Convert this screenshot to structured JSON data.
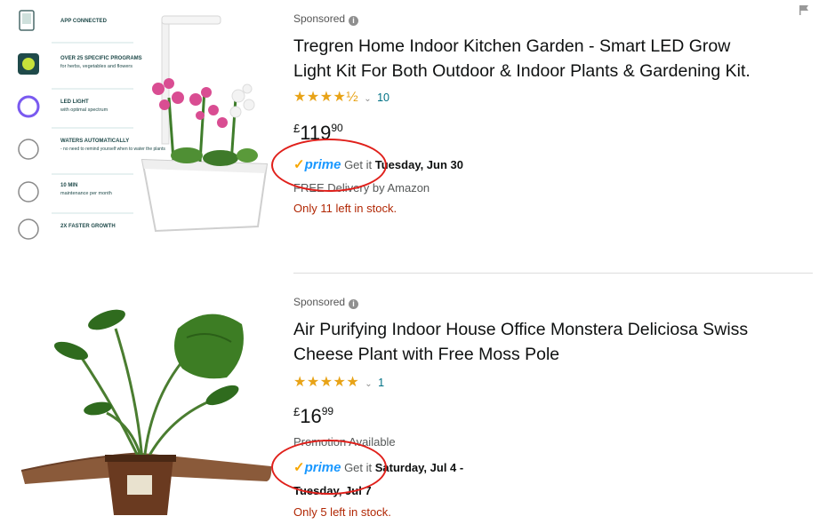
{
  "results": [
    {
      "sponsored_label": "Sponsored",
      "title_line1": "Tregren Home Indoor Kitchen Garden - Smart LED Grow",
      "title_line2": "Light Kit For Both Outdoor & Indoor Plants & Gardening Kit.",
      "stars": "★★★★½",
      "rating_count": "10",
      "price_currency": "£",
      "price_whole": "119",
      "price_fraction": "90",
      "prime_label": "prime",
      "delivery_prefix": "Get it",
      "delivery_date": "Tuesday, Jun 30",
      "extra_line": "FREE Delivery by Amazon",
      "stock": "Only 11 left in stock.",
      "features": [
        {
          "title": "APP CONNECTED",
          "desc": ""
        },
        {
          "title": "OVER 25 SPECIFIC PROGRAMS",
          "desc": "for herbs, vegetables and flowers"
        },
        {
          "title": "LED LIGHT",
          "desc": "with optimal spectrum"
        },
        {
          "title": "WATERS AUTOMATICALLY",
          "desc": "- no need to remind yourself when to water the plants"
        },
        {
          "title": "10 MIN",
          "desc": "maintenance per month"
        },
        {
          "title": "2X FASTER GROWTH",
          "desc": ""
        }
      ]
    },
    {
      "sponsored_label": "Sponsored",
      "title_line1": "Air Purifying Indoor House Office Monstera Deliciosa Swiss",
      "title_line2": "Cheese Plant with Free Moss Pole",
      "stars": "★★★★★",
      "rating_count": "1",
      "price_currency": "£",
      "price_whole": "16",
      "price_fraction": "99",
      "promotion": "Promotion Available",
      "prime_label": "prime",
      "delivery_prefix": "Get it",
      "delivery_date": "Saturday, Jul 4 -",
      "delivery_date2": "Tuesday, Jul 7",
      "stock": "Only 5 left in stock."
    }
  ],
  "colors": {
    "prime_blue": "#1a98ff",
    "star_orange": "#e8a317",
    "stock_red": "#b12704",
    "annotation_red": "#e0201b",
    "link_teal": "#007185"
  },
  "icons": [
    "info-icon",
    "flag-icon",
    "prime-check-icon",
    "chevron-down-icon"
  ]
}
